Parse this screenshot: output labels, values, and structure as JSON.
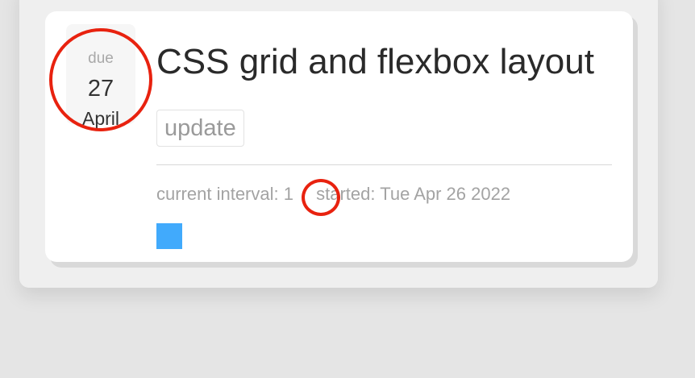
{
  "task": {
    "due_label": "due",
    "due_day": "27",
    "due_month": "April",
    "title": "CSS grid and flexbox layout",
    "tag": "update",
    "interval_label": "current interval:",
    "interval_value": "1",
    "started_label": "started:",
    "started_value": "Tue Apr 26 2022"
  },
  "colors": {
    "swatch": "#41aafc",
    "highlight_ring": "#e8220f"
  }
}
